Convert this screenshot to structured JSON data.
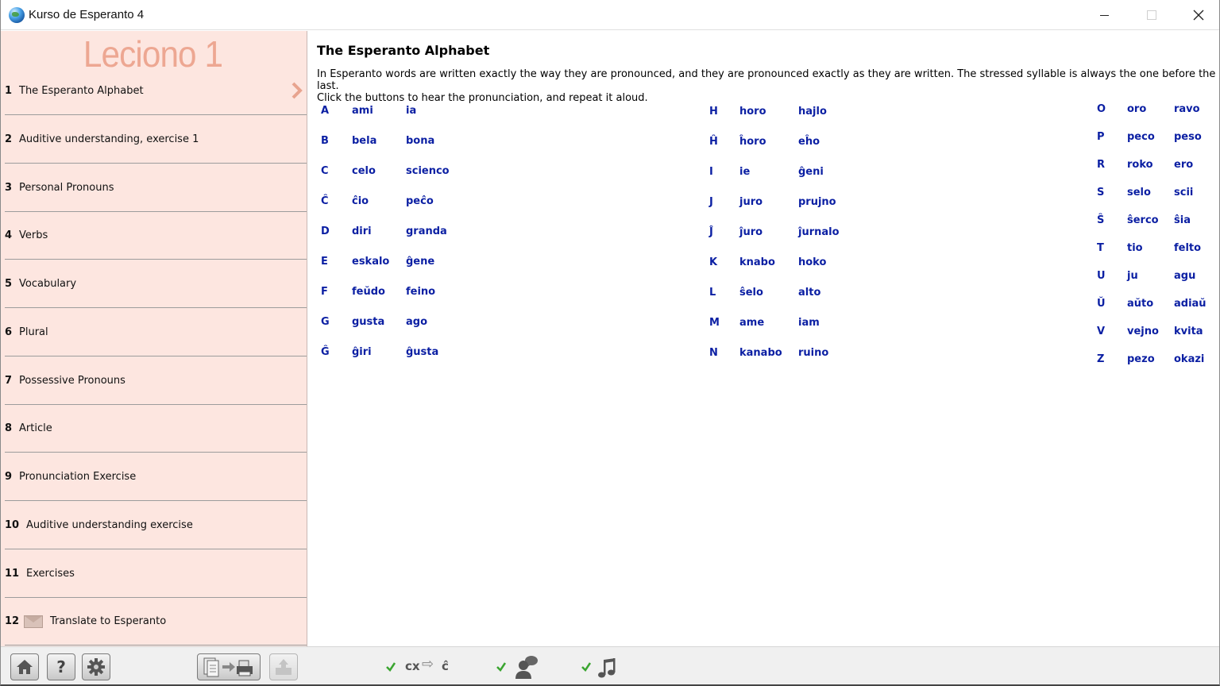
{
  "window": {
    "title": "Kurso de Esperanto 4",
    "close_glyph": "✕"
  },
  "sidebar": {
    "lesson_title": "Leciono 1",
    "items": [
      {
        "num": "1",
        "label": "The Esperanto Alphabet",
        "active": true
      },
      {
        "num": "2",
        "label": "Auditive understanding, exercise 1"
      },
      {
        "num": "3",
        "label": "Personal Pronouns"
      },
      {
        "num": "4",
        "label": "Verbs"
      },
      {
        "num": "5",
        "label": "Vocabulary"
      },
      {
        "num": "6",
        "label": "Plural"
      },
      {
        "num": "7",
        "label": "Possessive Pronouns"
      },
      {
        "num": "8",
        "label": "Article"
      },
      {
        "num": "9",
        "label": "Pronunciation Exercise"
      },
      {
        "num": "10",
        "label": "Auditive understanding exercise"
      },
      {
        "num": "11",
        "label": "Exercises"
      },
      {
        "num": "12",
        "label": "Translate to Esperanto",
        "icon": "envelope-icon"
      }
    ]
  },
  "content": {
    "title": "The Esperanto Alphabet",
    "intro_line1": "In Esperanto words are written exactly the way they are pronounced, and they are pronounced exactly as they are written. The stressed syllable is always the one before the last.",
    "intro_line2": "Click the buttons to hear the pronunciation, and repeat it aloud.",
    "columns": [
      [
        [
          "A",
          "ami",
          "ia"
        ],
        [
          "B",
          "bela",
          "bona"
        ],
        [
          "C",
          "celo",
          "scienco"
        ],
        [
          "Ĉ",
          "ĉio",
          "peĉo"
        ],
        [
          "D",
          "diri",
          "granda"
        ],
        [
          "E",
          "eskalo",
          "ĝene"
        ],
        [
          "F",
          "feŭdo",
          "feino"
        ],
        [
          "G",
          "gusta",
          "ago"
        ],
        [
          "Ĝ",
          "ĝiri",
          "ĝusta"
        ]
      ],
      [
        [
          "H",
          "horo",
          "hajlo"
        ],
        [
          "Ĥ",
          "ĥoro",
          "eĥo"
        ],
        [
          "I",
          "ie",
          "ĝeni"
        ],
        [
          "J",
          "juro",
          "prujno"
        ],
        [
          "Ĵ",
          "ĵuro",
          "ĵurnalo"
        ],
        [
          "K",
          "knabo",
          "hoko"
        ],
        [
          "L",
          "ŝelo",
          "alto"
        ],
        [
          "M",
          "ame",
          "iam"
        ],
        [
          "N",
          "kanabo",
          "ruino"
        ]
      ],
      [
        [
          "O",
          "oro",
          "ravo"
        ],
        [
          "P",
          "peco",
          "peso"
        ],
        [
          "R",
          "roko",
          "ero"
        ],
        [
          "S",
          "selo",
          "scii"
        ],
        [
          "Ŝ",
          "ŝerco",
          "ŝia"
        ],
        [
          "T",
          "tio",
          "felto"
        ],
        [
          "U",
          "ju",
          "agu"
        ],
        [
          "Ŭ",
          "aŭto",
          "adiaŭ"
        ],
        [
          "V",
          "vejno",
          "kvita"
        ],
        [
          "Z",
          "pezo",
          "okazi"
        ]
      ]
    ]
  },
  "toolbar": {
    "help_glyph": "?",
    "cx_label": "cx",
    "cx_target": "ĉ",
    "arrow_glyph": "⇨",
    "icons": [
      "home-icon",
      "help-icon",
      "gear-icon",
      "print-icon",
      "upload-icon",
      "checkmark-icon",
      "speaker-icon",
      "music-note-icon"
    ],
    "colors": {
      "check": "#3aa530",
      "link": "#0b1fa3",
      "sidebar_bg": "#fde6e0",
      "lesson_title": "#eda792"
    }
  }
}
